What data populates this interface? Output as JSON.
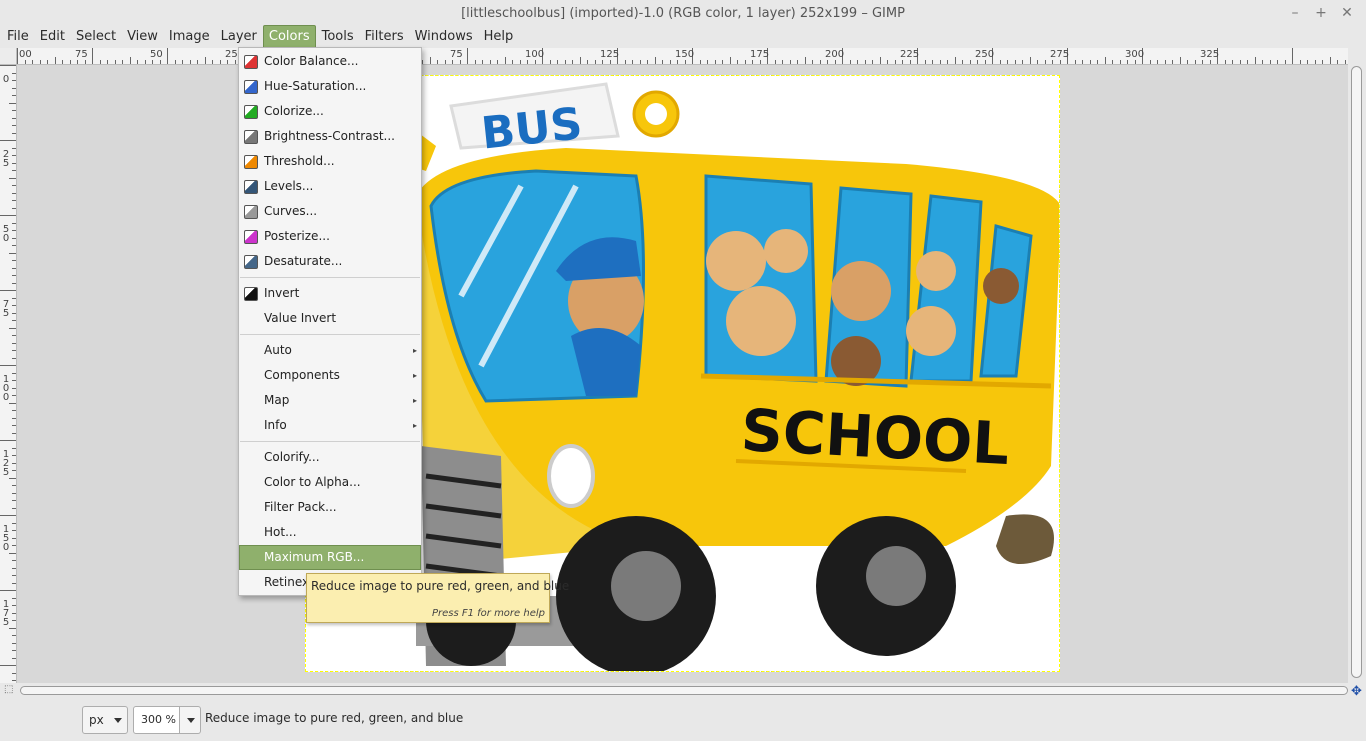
{
  "window": {
    "title": "[littleschoolbus] (imported)-1.0 (RGB color, 1 layer) 252x199 – GIMP",
    "minimize": "–",
    "maximize": "+",
    "close": "✕"
  },
  "menubar": [
    "File",
    "Edit",
    "Select",
    "View",
    "Image",
    "Layer",
    "Colors",
    "Tools",
    "Filters",
    "Windows",
    "Help"
  ],
  "menubar_active": "Colors",
  "ruler": {
    "top_labels": [
      "00",
      "75",
      "50",
      "25",
      "25",
      "50",
      "75",
      "100",
      "125",
      "150",
      "175",
      "200",
      "225",
      "250",
      "275",
      "300",
      "325"
    ],
    "left_labels": [
      "0",
      "25",
      "50",
      "75",
      "100",
      "125",
      "150",
      "175"
    ]
  },
  "colors_menu": {
    "group1": [
      {
        "label": "Color Balance...",
        "icon": "color-balance-icon"
      },
      {
        "label": "Hue-Saturation...",
        "icon": "hue-saturation-icon"
      },
      {
        "label": "Colorize...",
        "icon": "colorize-icon"
      },
      {
        "label": "Brightness-Contrast...",
        "icon": "brightness-contrast-icon"
      },
      {
        "label": "Threshold...",
        "icon": "threshold-icon"
      },
      {
        "label": "Levels...",
        "icon": "levels-icon"
      },
      {
        "label": "Curves...",
        "icon": "curves-icon"
      },
      {
        "label": "Posterize...",
        "icon": "posterize-icon"
      },
      {
        "label": "Desaturate...",
        "icon": "desaturate-icon"
      }
    ],
    "group2": [
      {
        "label": "Invert",
        "icon": "invert-icon"
      },
      {
        "label": "Value Invert",
        "icon": ""
      }
    ],
    "group3": [
      {
        "label": "Auto",
        "submenu": true
      },
      {
        "label": "Components",
        "submenu": true
      },
      {
        "label": "Map",
        "submenu": true
      },
      {
        "label": "Info",
        "submenu": true
      }
    ],
    "group4": [
      {
        "label": "Colorify..."
      },
      {
        "label": "Color to Alpha..."
      },
      {
        "label": "Filter Pack..."
      },
      {
        "label": "Hot..."
      },
      {
        "label": "Maximum RGB...",
        "highlighted": true
      },
      {
        "label": "Retinex..."
      }
    ]
  },
  "tooltip": {
    "text": "Reduce image to pure red, green, and blue",
    "help": "Press F1 for more help"
  },
  "image": {
    "bus_sign": "BUS",
    "side_text": "SCHOOL"
  },
  "statusbar": {
    "unit": "px",
    "zoom": "300 %",
    "message": "Reduce image to pure red, green, and blue"
  },
  "colors": {
    "accent": "#8fb06c",
    "bus_yellow": "#f7c60b",
    "window_blue": "#29a3dd",
    "tooltip_bg": "#fbeeb0"
  }
}
